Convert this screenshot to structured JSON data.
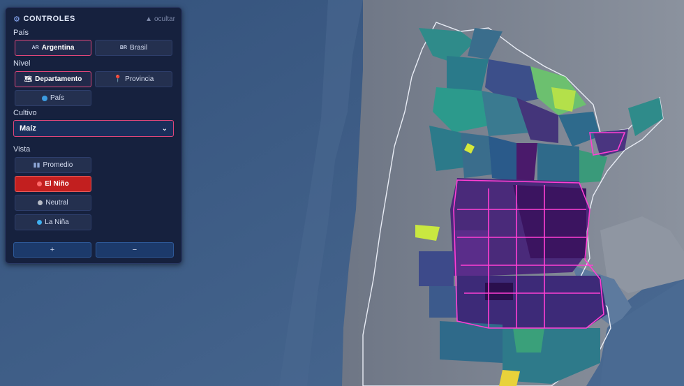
{
  "panel": {
    "title": "CONTROLES",
    "hide_label": "ocultar",
    "country_label": "País",
    "countries": [
      {
        "code": "AR",
        "label": "Argentina",
        "active": true
      },
      {
        "code": "BR",
        "label": "Brasil",
        "active": false
      }
    ],
    "level_label": "Nivel",
    "levels": [
      {
        "label": "Departamento",
        "icon": "map-icon",
        "active": true
      },
      {
        "label": "Provincia",
        "icon": "pin-icon",
        "active": false
      },
      {
        "label": "País",
        "icon": "globe-icon",
        "active": false
      }
    ],
    "crop_label": "Cultivo",
    "crop_selected": "Maíz",
    "view_label": "Vista",
    "views": [
      {
        "label": "Promedio",
        "icon": "bar-chart-icon",
        "active": false
      },
      {
        "label": "El Niño",
        "icon": "red-dot-icon",
        "active": true
      },
      {
        "label": "Neutral",
        "icon": "gray-dot-icon",
        "active": false
      },
      {
        "label": "La Niña",
        "icon": "blue-dot-icon",
        "active": false
      }
    ],
    "zoom_in": "+",
    "zoom_out": "−"
  },
  "colors": {
    "panel_bg": "#16213e",
    "active_border": "#e0467a",
    "el_nino": "#c21f1f",
    "ocean": "#3b5a82",
    "land": "#7d8594",
    "highlight": "#ff3fd4"
  }
}
